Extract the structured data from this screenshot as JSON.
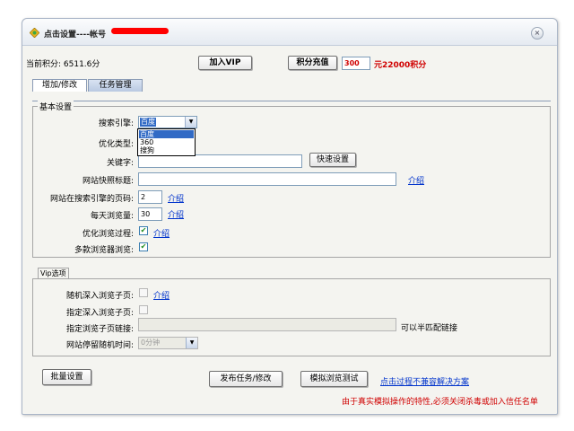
{
  "window": {
    "title": "点击设置----帐号",
    "close_icon": "×"
  },
  "top": {
    "score_label": "当前积分: 6511.6分",
    "join_vip": "加入VIP",
    "recharge": "积分充值",
    "recharge_amount": "300",
    "recharge_result": "元22000积分"
  },
  "tabs": [
    {
      "label": "增加/修改"
    },
    {
      "label": "任务管理"
    }
  ],
  "basic": {
    "group_title": "基本设置",
    "search_engine_label": "搜索引擎:",
    "search_engine_value": "百度",
    "search_engine_options": [
      "百度",
      "360",
      "搜狗"
    ],
    "opt_type_label": "优化类型:",
    "keyword_label": "关键字:",
    "keyword_value": "",
    "quick_setup": "快速设置",
    "snapshot_title_label": "网站快照标题:",
    "snapshot_title_value": "",
    "intro1": "介绍",
    "pages_label": "网站在搜索引擎的页码:",
    "pages_value": "2",
    "intro2": "介绍",
    "daily_views_label": "每天浏览量:",
    "daily_views_value": "30",
    "intro3": "介绍",
    "optimize_process_label": "优化浏览过程:",
    "optimize_process_checked": true,
    "intro4": "介绍",
    "multi_browser_label": "多款浏览器浏览:",
    "multi_browser_checked": true
  },
  "vip": {
    "group_title": "Vip选项",
    "random_deep_label": "随机深入浏览子页:",
    "intro5": "介绍",
    "specify_deep_label": "指定深入浏览子页:",
    "specify_link_label": "指定浏览子页链接:",
    "specify_link_value": "",
    "half_match": "可以半匹配链接",
    "stay_time_label": "网站停留随机时间:",
    "stay_time_value": "0分钟"
  },
  "bottom": {
    "batch": "批量设置",
    "publish": "发布任务/修改",
    "simulate": "模拟浏览测试",
    "incompat_link": "点击过程不兼容解决方案",
    "note": "由于真实模拟操作的特性,必须关闭杀毒或加入信任名单"
  },
  "colors": {
    "accent_red": "#d00000",
    "link_blue": "#0033cc",
    "highlight": "#316ac5"
  }
}
